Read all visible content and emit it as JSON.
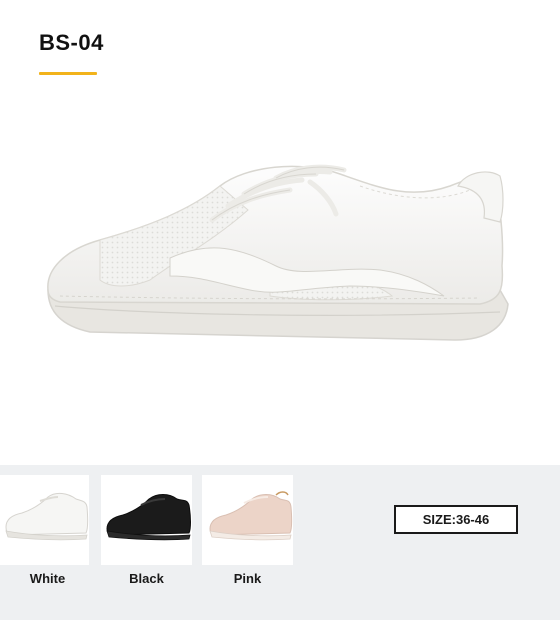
{
  "product": {
    "model": "BS-04",
    "accent_color": "#f2b31b",
    "hero_image": "white-low-top-sneaker"
  },
  "variants": [
    {
      "label": "White",
      "swatch": "#f4f4f2",
      "image": "white-sneaker-thumbnail"
    },
    {
      "label": "Black",
      "swatch": "#1b1b1b",
      "image": "black-sneaker-thumbnail"
    },
    {
      "label": "Pink",
      "swatch": "#ecd4c8",
      "image": "pink-sneaker-thumbnail"
    }
  ],
  "size": {
    "label": "SIZE:36-46"
  }
}
